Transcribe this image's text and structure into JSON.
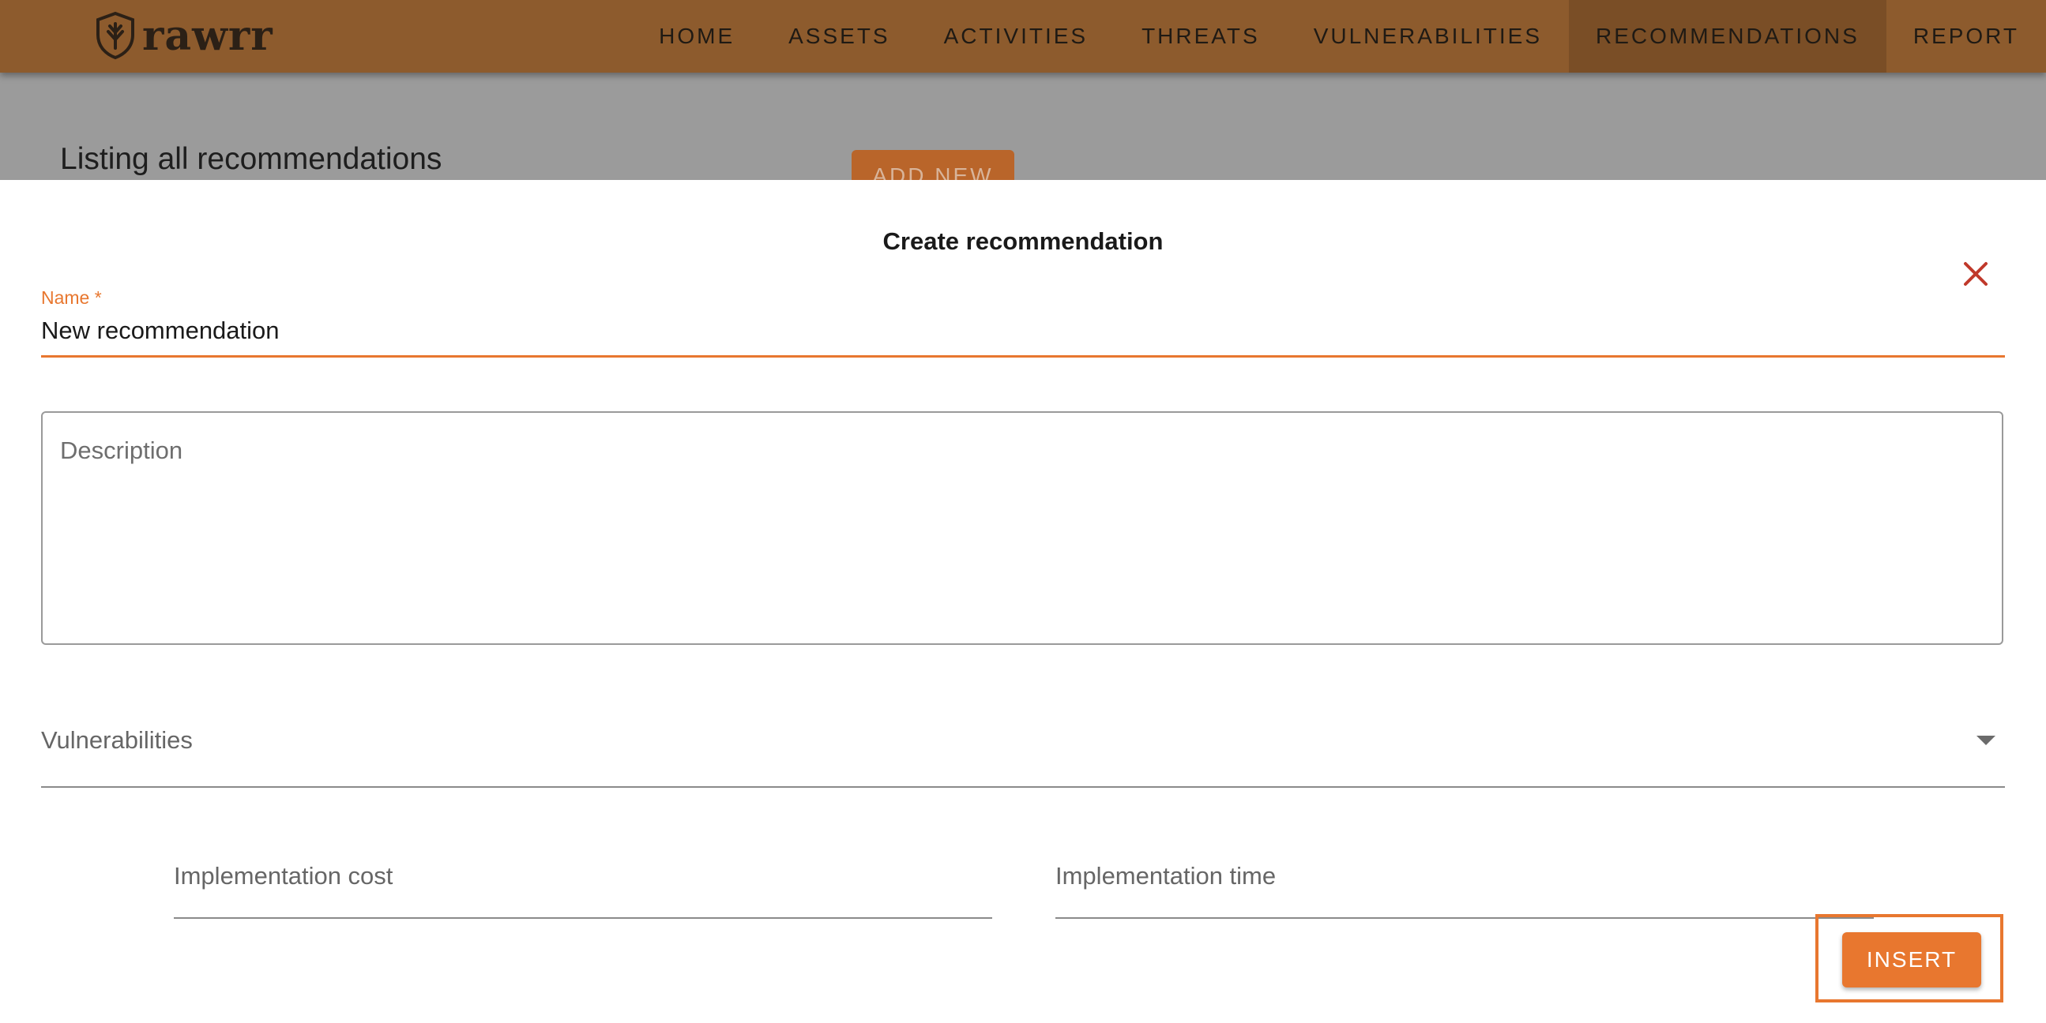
{
  "app": {
    "logo_text": "rawrr"
  },
  "nav": {
    "items": [
      {
        "label": "HOME"
      },
      {
        "label": "ASSETS"
      },
      {
        "label": "ACTIVITIES"
      },
      {
        "label": "THREATS"
      },
      {
        "label": "VULNERABILITIES"
      },
      {
        "label": "RECOMMENDATIONS",
        "active": true
      },
      {
        "label": "REPORT"
      }
    ]
  },
  "background": {
    "title": "Listing all recommendations",
    "add_new_label": "ADD NEW"
  },
  "dialog": {
    "title": "Create recommendation",
    "name_label": "Name *",
    "name_value": "New recommendation",
    "description_placeholder": "Description",
    "vulnerabilities_label": "Vulnerabilities",
    "implementation_cost_placeholder": "Implementation cost",
    "implementation_time_placeholder": "Implementation time",
    "insert_label": "INSERT"
  },
  "colors": {
    "navbar": "#8d5b2d",
    "navbar_active": "#7a4e26",
    "accent": "#e8772f",
    "close_icon": "#c0392b"
  },
  "icons": [
    "shield-logo-icon",
    "close-icon",
    "chevron-down-icon"
  ]
}
